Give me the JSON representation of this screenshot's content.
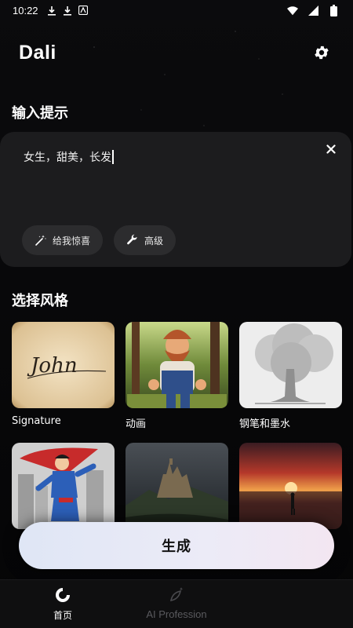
{
  "status_bar": {
    "time": "10:22"
  },
  "header": {
    "app_title": "Dali"
  },
  "prompt_section": {
    "title": "输入提示",
    "prompt_value": "女生，甜美，长发",
    "surprise_label": "给我惊喜",
    "advanced_label": "高级"
  },
  "style_section": {
    "title": "选择风格",
    "styles": [
      {
        "label": "Signature",
        "preview_text": "John"
      },
      {
        "label": "动画"
      },
      {
        "label": "钢笔和墨水"
      },
      {
        "label": ""
      },
      {
        "label": ""
      },
      {
        "label": ""
      }
    ]
  },
  "generate": {
    "label": "生成"
  },
  "bottom_nav": {
    "items": [
      {
        "label": "首页",
        "active": true
      },
      {
        "label": "AI Profession",
        "active": false
      }
    ]
  },
  "colors": {
    "background": "#050506",
    "card": "#1c1c1e",
    "pill": "#2c2c2e",
    "generate_start": "#dfe6f5",
    "generate_end": "#f3e6f1"
  }
}
